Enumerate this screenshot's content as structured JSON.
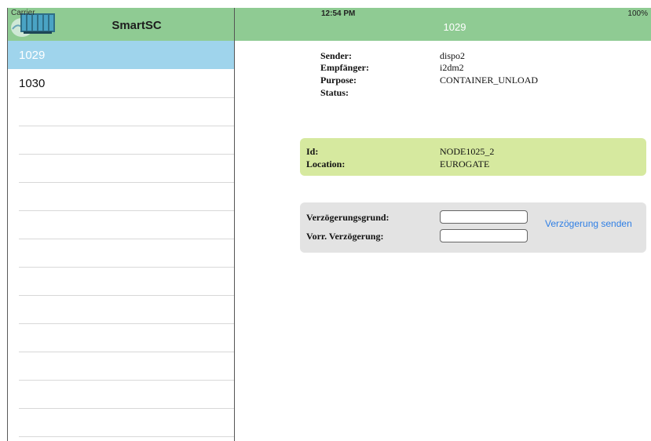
{
  "status_bar": {
    "carrier": "Carrier",
    "time": "12:54 PM",
    "battery": "100%"
  },
  "master": {
    "title": "SmartSC",
    "items": [
      {
        "label": "1029",
        "selected": true
      },
      {
        "label": "1030",
        "selected": false
      }
    ]
  },
  "detail": {
    "title": "1029",
    "info": [
      {
        "key": "Sender:",
        "value": "dispo2"
      },
      {
        "key": "Empfänger:",
        "value": "i2dm2"
      },
      {
        "key": "Purpose:",
        "value": "CONTAINER_UNLOAD"
      },
      {
        "key": "Status:",
        "value": ""
      }
    ],
    "node": {
      "id_label": "Id:",
      "id_value": "NODE1025_2",
      "location_label": "Location:",
      "location_value": "EUROGATE"
    },
    "delay": {
      "reason_label": "Verzögerungsgrund:",
      "expected_label": "Vorr. Verzögerung:",
      "reason_value": "",
      "expected_value": "",
      "send_label": "Verzögerung senden"
    }
  },
  "colors": {
    "header": "#8fcb93",
    "selected_row": "#9fd4ec",
    "node_box": "#d6e99f",
    "delay_box": "#e3e3e3",
    "link": "#2f7fe5"
  }
}
